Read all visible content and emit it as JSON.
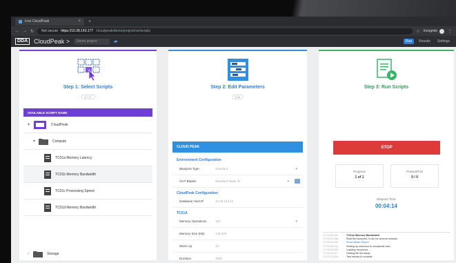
{
  "browser": {
    "tab_title": "Icon CloudPeak",
    "tab_close": "×",
    "tab_new": "+",
    "url_security": "Not secure",
    "url_domain": "https://10.38.143.177",
    "url_path": "/cloudpeak/demo/project/run/scripts",
    "user_label": "Incognito"
  },
  "app": {
    "logo": "DDA",
    "title": "CloudPeak",
    "title_sep": ">",
    "project_field": "Demo project",
    "right_buttons": [
      "Run",
      "Results",
      "Settings"
    ]
  },
  "step1": {
    "title": "Step 1: Select Scripts",
    "pill": "8 / 17",
    "tree_header": "AVAILABLE SCRIPT NAME",
    "tree": [
      {
        "label": "CloudPeak",
        "type": "root",
        "expander": "▾"
      },
      {
        "label": "Compute",
        "type": "folder",
        "expander": "▾"
      },
      {
        "label": "TC01a Memory Latency",
        "type": "script",
        "expander": ""
      },
      {
        "label": "TC01b Memory Bandwidth",
        "type": "script",
        "expander": ""
      },
      {
        "label": "TC01c Processing Speed",
        "type": "script",
        "expander": ""
      },
      {
        "label": "TC01d Memory Bandwidth",
        "type": "script",
        "expander": ""
      },
      {
        "label": "Storage",
        "type": "folder",
        "expander": "›"
      }
    ]
  },
  "step2": {
    "title": "Step 2: Edit Parameters",
    "pill": "Edit",
    "config_header": "CLOUD PEAK",
    "sections": [
      {
        "name": "Environment Configuration",
        "rows": [
          {
            "label": "Blueprint Type",
            "value": "Standard",
            "control": "select"
          },
          {
            "label": "OUT Blades",
            "value": "Standard blade 01",
            "control": "select-button"
          }
        ]
      },
      {
        "name": "CloudPeak Configuration",
        "rows": [
          {
            "label": "Database Host IP",
            "value": "10.38.143.10",
            "control": "text"
          }
        ]
      },
      {
        "name": "TC01A",
        "rows": [
          {
            "label": "Memory Operations",
            "value": "100",
            "control": "select"
          },
          {
            "label": "Memory Size (KB)",
            "value": "128 000",
            "control": "text"
          },
          {
            "label": "Warm up",
            "value": "10",
            "control": "text"
          },
          {
            "label": "Duration",
            "value": "1800",
            "control": "text"
          }
        ]
      }
    ]
  },
  "step3": {
    "title": "Step 3: Run Scripts",
    "stop_label": "STOP",
    "progress_label": "Progress",
    "progress_value": "1 of 1",
    "passed_label": "Passed/Fail",
    "passed_value": "0 / 0",
    "elapsed_label": "Elapsed Time",
    "elapsed_value": "00:04:14",
    "log": [
      {
        "ts": "17:23:05.254",
        "msg": "TC01A Memory Bandwidth",
        "style": "bd"
      },
      {
        "ts": "17:23:05.268",
        "msg": "Start the blueprint, it can be several minutes",
        "style": ""
      },
      {
        "ts": "17:23:05.312",
        "msg": "Show Blade Report",
        "style": "hl"
      },
      {
        "ts": "17:23:06.441",
        "msg": "Setting up resource to cloudpeak user",
        "style": ""
      },
      {
        "ts": "17:23:08.020",
        "msg": "Loading resources ...",
        "style": ""
      },
      {
        "ts": "17:23:09.117",
        "msg": "Getting file list ready",
        "style": ""
      },
      {
        "ts": "17:23:10.004",
        "msg": "Test results to console",
        "style": ""
      }
    ]
  },
  "colors": {
    "step1_accent": "#6d3fd6",
    "step2_accent": "#2f8fe0",
    "step3_accent": "#39b56a",
    "stop": "#dd3a3a",
    "app_bar": "#2c2e33"
  },
  "icons": {
    "step1": "cursor-select-icon",
    "step2": "sliders-form-icon",
    "step3": "document-play-icon"
  }
}
